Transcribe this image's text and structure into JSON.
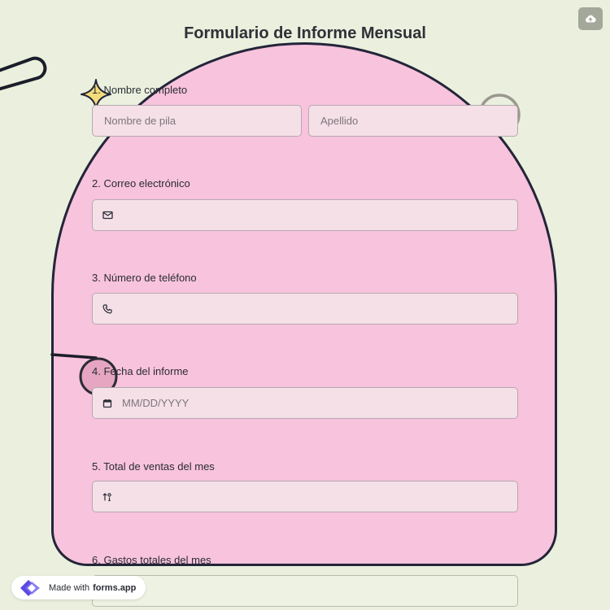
{
  "form": {
    "title": "Formulario de Informe Mensual",
    "questions": [
      {
        "label": "1. Nombre completo",
        "first_placeholder": "Nombre de pila",
        "last_placeholder": "Apellido"
      },
      {
        "label": "2. Correo electrónico",
        "placeholder": "",
        "icon": "mail-icon"
      },
      {
        "label": "3. Número de teléfono",
        "placeholder": "",
        "icon": "phone-icon"
      },
      {
        "label": "4. Fecha del informe",
        "placeholder": "MM/DD/YYYY",
        "icon": "calendar-icon"
      },
      {
        "label": "5. Total de ventas del mes",
        "placeholder": "",
        "icon": "number-icon"
      },
      {
        "label": "6. Gastos totales del mes",
        "placeholder": ""
      }
    ]
  },
  "toolbar": {
    "cloud_icon": "cloud-upload-icon"
  },
  "badge": {
    "made_with": "Made with",
    "brand": "forms.app"
  },
  "colors": {
    "background": "#eaf0dd",
    "arch": "#f8c3dc",
    "outline": "#23253a",
    "star": "#f4dc7a"
  }
}
